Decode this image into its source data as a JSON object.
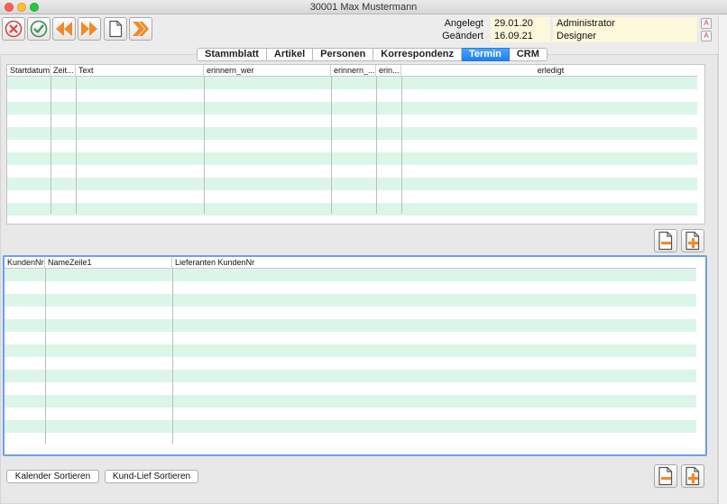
{
  "window": {
    "title": "30001 Max Mustermann"
  },
  "toolbar": {
    "buttons": [
      {
        "name": "cancel",
        "icon": "x-circle-icon"
      },
      {
        "name": "confirm",
        "icon": "check-circle-icon"
      },
      {
        "name": "previous",
        "icon": "double-chevron-left-icon"
      },
      {
        "name": "next",
        "icon": "double-chevron-right-icon"
      },
      {
        "name": "new-document",
        "icon": "document-icon"
      },
      {
        "name": "forward",
        "icon": "double-chevron-right-icon"
      }
    ]
  },
  "meta": {
    "created_label": "Angelegt",
    "created_date": "29.01.20",
    "created_by": "Administrator",
    "changed_label": "Geändert",
    "changed_date": "16.09.21",
    "changed_by": "Designer"
  },
  "tabs": [
    {
      "label": "Stammblatt",
      "active": false
    },
    {
      "label": "Artikel",
      "active": false
    },
    {
      "label": "Personen",
      "active": false
    },
    {
      "label": "Korrespondenz",
      "active": false
    },
    {
      "label": "Termin",
      "active": true
    },
    {
      "label": "CRM",
      "active": false
    }
  ],
  "termin_table": {
    "columns": [
      "Startdatum",
      "Zeit...",
      "Text",
      "erinnern_wer",
      "erinnern_...",
      "erin...",
      "erledigt"
    ],
    "rows": []
  },
  "kunden_table": {
    "columns": [
      "KundenNr",
      "NameZeile1",
      "Lieferanten KundenNr"
    ],
    "rows": []
  },
  "buttons": {
    "sort_calendar": "Kalender Sortieren",
    "sort_customer_supplier": "Kund-Lief Sortieren"
  },
  "colors": {
    "row_alt": "#dbf6e8",
    "tab_active": "#1f7ef2",
    "selection_border": "#6aa0ee",
    "field_bg": "#fdf7dc"
  }
}
